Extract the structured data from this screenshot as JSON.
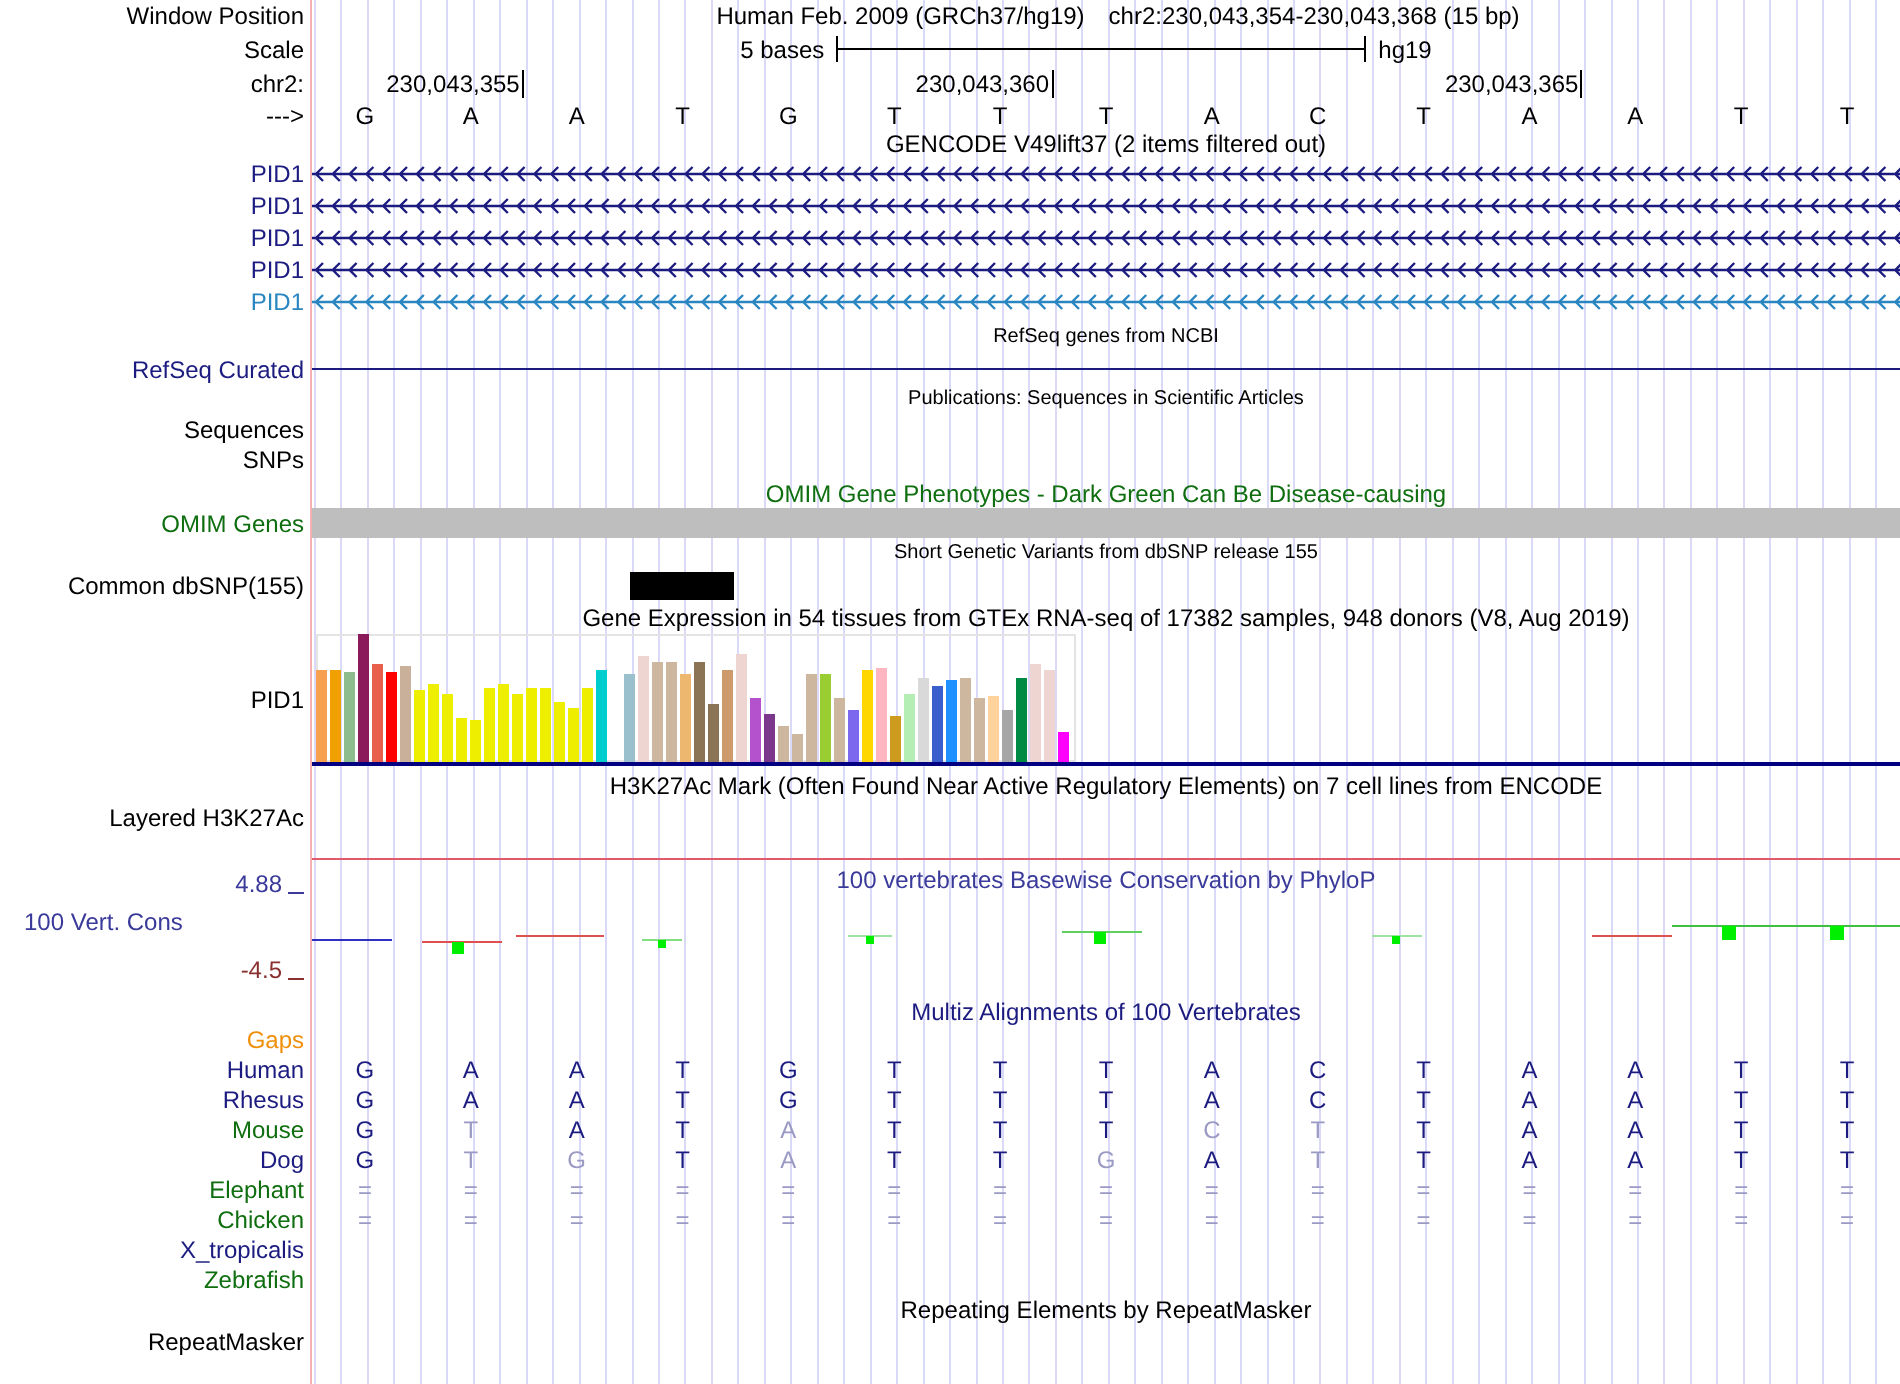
{
  "header": {
    "label": "Window Position",
    "title": "Human Feb. 2009 (GRCh37/hg19)",
    "position": "chr2:230,043,354-230,043,368 (15 bp)"
  },
  "scale": {
    "label": "Scale",
    "length": "5 bases",
    "assembly": "hg19"
  },
  "ruler": {
    "label": "chr2:",
    "ticks": [
      "230,043,355",
      "230,043,360",
      "230,043,365"
    ]
  },
  "sequence": {
    "label": "--->",
    "bases": [
      "G",
      "A",
      "A",
      "T",
      "G",
      "T",
      "T",
      "T",
      "A",
      "C",
      "T",
      "A",
      "A",
      "T",
      "T"
    ]
  },
  "gencode": {
    "title": "GENCODE V49lift37 (2 items filtered out)",
    "transcripts": [
      {
        "name": "PID1",
        "color": "#1c1c80"
      },
      {
        "name": "PID1",
        "color": "#1c1c80"
      },
      {
        "name": "PID1",
        "color": "#1c1c80"
      },
      {
        "name": "PID1",
        "color": "#1c1c80"
      },
      {
        "name": "PID1",
        "color": "#2a86c0"
      }
    ]
  },
  "refseq": {
    "title": "RefSeq genes from NCBI",
    "label": "RefSeq Curated"
  },
  "publications": {
    "title": "Publications: Sequences in Scientific Articles",
    "labels": [
      "Sequences",
      "SNPs"
    ]
  },
  "omim": {
    "title": "OMIM Gene Phenotypes - Dark Green Can Be Disease-causing",
    "label": "OMIM Genes"
  },
  "dbsnp": {
    "title": "Short Genetic Variants from dbSNP release 155",
    "label": "Common dbSNP(155)"
  },
  "gtex": {
    "title": "Gene Expression in 54 tissues from GTEx RNA-seq of 17382 samples, 948 donors (V8, Aug 2019)",
    "label": "PID1"
  },
  "h3k27ac": {
    "title": "H3K27Ac Mark (Often Found Near Active Regulatory Elements) on 7 cell lines from ENCODE",
    "label": "Layered H3K27Ac"
  },
  "phylop": {
    "title": "100 vertebrates Basewise Conservation by PhyloP",
    "label": "100 Vert. Cons",
    "max": "4.88",
    "min": "-4.5"
  },
  "multiz": {
    "title": "Multiz Alignments of 100 Vertebrates",
    "gaps_label": "Gaps",
    "species": [
      {
        "name": "Human",
        "color": "#1c1c80",
        "bases": [
          {
            "text": "G",
            "faded": false
          },
          {
            "text": "A",
            "faded": false
          },
          {
            "text": "A",
            "faded": false
          },
          {
            "text": "T",
            "faded": false
          },
          {
            "text": "G",
            "faded": false
          },
          {
            "text": "T",
            "faded": false
          },
          {
            "text": "T",
            "faded": false
          },
          {
            "text": "T",
            "faded": false
          },
          {
            "text": "A",
            "faded": false
          },
          {
            "text": "C",
            "faded": false
          },
          {
            "text": "T",
            "faded": false
          },
          {
            "text": "A",
            "faded": false
          },
          {
            "text": "A",
            "faded": false
          },
          {
            "text": "T",
            "faded": false
          },
          {
            "text": "T",
            "faded": false
          }
        ]
      },
      {
        "name": "Rhesus",
        "color": "#1c1c80",
        "bases": [
          {
            "text": "G",
            "faded": false
          },
          {
            "text": "A",
            "faded": false
          },
          {
            "text": "A",
            "faded": false
          },
          {
            "text": "T",
            "faded": false
          },
          {
            "text": "G",
            "faded": false
          },
          {
            "text": "T",
            "faded": false
          },
          {
            "text": "T",
            "faded": false
          },
          {
            "text": "T",
            "faded": false
          },
          {
            "text": "A",
            "faded": false
          },
          {
            "text": "C",
            "faded": false
          },
          {
            "text": "T",
            "faded": false
          },
          {
            "text": "A",
            "faded": false
          },
          {
            "text": "A",
            "faded": false
          },
          {
            "text": "T",
            "faded": false
          },
          {
            "text": "T",
            "faded": false
          }
        ]
      },
      {
        "name": "Mouse",
        "color": "#0f6e0f",
        "bases": [
          {
            "text": "G",
            "faded": false
          },
          {
            "text": "T",
            "faded": true
          },
          {
            "text": "A",
            "faded": false
          },
          {
            "text": "T",
            "faded": false
          },
          {
            "text": "A",
            "faded": true
          },
          {
            "text": "T",
            "faded": false
          },
          {
            "text": "T",
            "faded": false
          },
          {
            "text": "T",
            "faded": false
          },
          {
            "text": "C",
            "faded": true
          },
          {
            "text": "T",
            "faded": true
          },
          {
            "text": "T",
            "faded": false
          },
          {
            "text": "A",
            "faded": false
          },
          {
            "text": "A",
            "faded": false
          },
          {
            "text": "T",
            "faded": false
          },
          {
            "text": "T",
            "faded": false
          }
        ]
      },
      {
        "name": "Dog",
        "color": "#1c1c80",
        "bases": [
          {
            "text": "G",
            "faded": false
          },
          {
            "text": "T",
            "faded": true
          },
          {
            "text": "G",
            "faded": true
          },
          {
            "text": "T",
            "faded": false
          },
          {
            "text": "A",
            "faded": true
          },
          {
            "text": "T",
            "faded": false
          },
          {
            "text": "T",
            "faded": false
          },
          {
            "text": "G",
            "faded": true
          },
          {
            "text": "A",
            "faded": false
          },
          {
            "text": "T",
            "faded": true
          },
          {
            "text": "T",
            "faded": false
          },
          {
            "text": "A",
            "faded": false
          },
          {
            "text": "A",
            "faded": false
          },
          {
            "text": "T",
            "faded": false
          },
          {
            "text": "T",
            "faded": false
          }
        ]
      },
      {
        "name": "Elephant",
        "color": "#0f6e0f",
        "bases": [
          {
            "text": "=",
            "faded": true
          },
          {
            "text": "=",
            "faded": true
          },
          {
            "text": "=",
            "faded": true
          },
          {
            "text": "=",
            "faded": true
          },
          {
            "text": "=",
            "faded": true
          },
          {
            "text": "=",
            "faded": true
          },
          {
            "text": "=",
            "faded": true
          },
          {
            "text": "=",
            "faded": true
          },
          {
            "text": "=",
            "faded": true
          },
          {
            "text": "=",
            "faded": true
          },
          {
            "text": "=",
            "faded": true
          },
          {
            "text": "=",
            "faded": true
          },
          {
            "text": "=",
            "faded": true
          },
          {
            "text": "=",
            "faded": true
          },
          {
            "text": "=",
            "faded": true
          }
        ]
      },
      {
        "name": "Chicken",
        "color": "#0f6e0f",
        "bases": [
          {
            "text": "=",
            "faded": true
          },
          {
            "text": "=",
            "faded": true
          },
          {
            "text": "=",
            "faded": true
          },
          {
            "text": "=",
            "faded": true
          },
          {
            "text": "=",
            "faded": true
          },
          {
            "text": "=",
            "faded": true
          },
          {
            "text": "=",
            "faded": true
          },
          {
            "text": "=",
            "faded": true
          },
          {
            "text": "=",
            "faded": true
          },
          {
            "text": "=",
            "faded": true
          },
          {
            "text": "=",
            "faded": true
          },
          {
            "text": "=",
            "faded": true
          },
          {
            "text": "=",
            "faded": true
          },
          {
            "text": "=",
            "faded": true
          },
          {
            "text": "=",
            "faded": true
          }
        ]
      },
      {
        "name": "X_tropicalis",
        "color": "#1c1c80"
      },
      {
        "name": "Zebrafish",
        "color": "#0f6e0f"
      }
    ]
  },
  "repeatmasker": {
    "title": "Repeating Elements by RepeatMasker",
    "label": "RepeatMasker"
  }
}
